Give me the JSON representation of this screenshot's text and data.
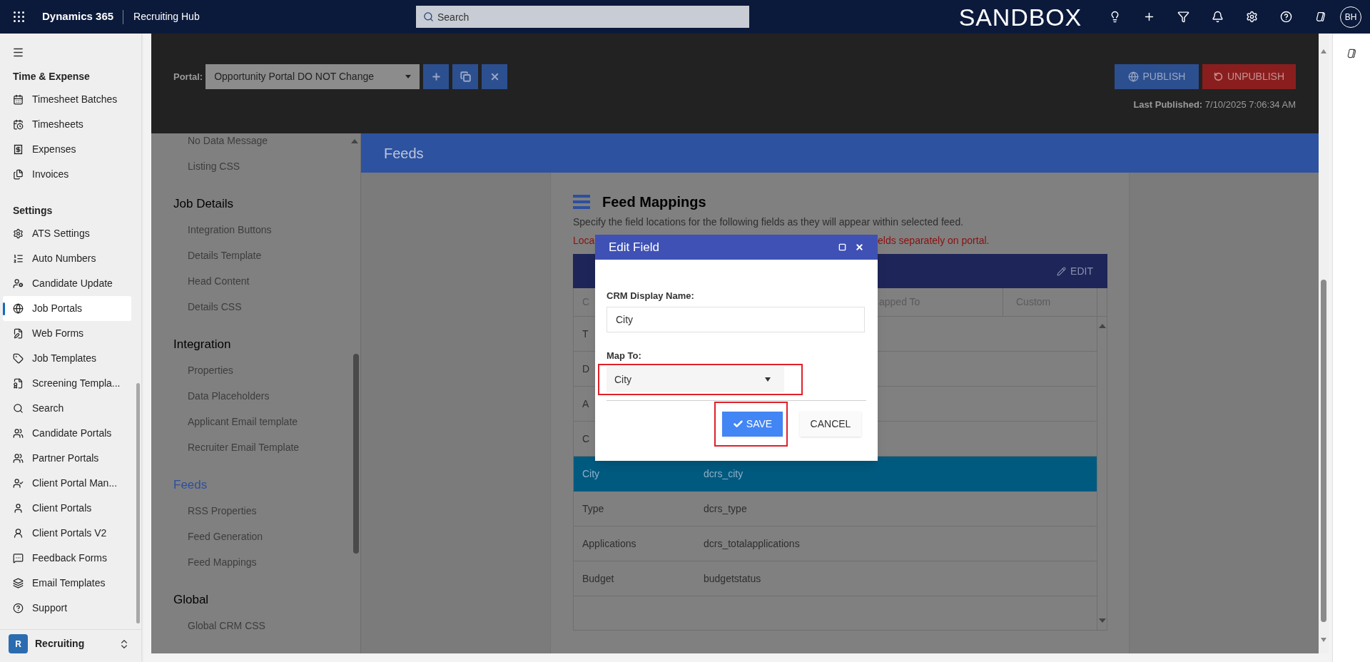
{
  "top_bar": {
    "app_name": "Dynamics 365",
    "area": "Recruiting Hub",
    "search": {
      "placeholder": "Search"
    },
    "environment": "SANDBOX",
    "user_initials": "BH"
  },
  "sidebar": {
    "groups": [
      {
        "title": "Time & Expense",
        "items": [
          {
            "label": "Timesheet Batches",
            "selected": false
          },
          {
            "label": "Timesheets",
            "selected": false
          },
          {
            "label": "Expenses",
            "selected": false
          },
          {
            "label": "Invoices",
            "selected": false
          }
        ]
      },
      {
        "title": "Settings",
        "items": [
          {
            "label": "ATS Settings",
            "selected": false
          },
          {
            "label": "Auto Numbers",
            "selected": false
          },
          {
            "label": "Candidate Update",
            "selected": false
          },
          {
            "label": "Job Portals",
            "selected": true
          },
          {
            "label": "Web Forms",
            "selected": false
          },
          {
            "label": "Job Templates",
            "selected": false
          },
          {
            "label": "Screening Templa...",
            "selected": false
          },
          {
            "label": "Search",
            "selected": false
          },
          {
            "label": "Candidate Portals",
            "selected": false
          },
          {
            "label": "Partner Portals",
            "selected": false
          },
          {
            "label": "Client Portal Man...",
            "selected": false
          },
          {
            "label": "Client Portals",
            "selected": false
          },
          {
            "label": "Client Portals V2",
            "selected": false
          },
          {
            "label": "Feedback Forms",
            "selected": false
          },
          {
            "label": "Email Templates",
            "selected": false
          },
          {
            "label": "Support",
            "selected": false
          }
        ]
      }
    ],
    "area_switcher": {
      "initial": "R",
      "label": "Recruiting"
    }
  },
  "portal_bar": {
    "label": "Portal:",
    "portal": "Opportunity Portal DO NOT Change",
    "publish": "PUBLISH",
    "unpublish": "UNPUBLISH",
    "last_published": "**Last Published:** 7/10/2025 7:06:34 AM"
  },
  "portal_menu": {
    "sections": [
      {
        "items": [
          "No Data Message",
          "Listing CSS"
        ]
      },
      {
        "title": "Job Details",
        "selected": false,
        "items": [
          "Integration Buttons",
          "Details Template",
          "Head Content",
          "Details CSS"
        ]
      },
      {
        "title": "Integration",
        "selected": false,
        "items": [
          "Properties",
          "Data Placeholders",
          "Applicant Email template",
          "Recruiter Email Template"
        ]
      },
      {
        "title": "Feeds",
        "selected": true,
        "items": [
          "RSS Properties",
          "Feed Generation",
          "Feed Mappings"
        ]
      },
      {
        "title": "Global",
        "selected": false,
        "items": [
          "Global CRM CSS"
        ]
      }
    ]
  },
  "page_header": "Feeds",
  "feed_mappings": {
    "title": "Feed Mappings",
    "description": "Specify the field locations for the following fields as they will appear within selected feed.",
    "warning_start": "Loca",
    "warning_end": "elds separately on portal.",
    "table": {
      "edit": "EDIT",
      "columns": [
        "C",
        "apped To",
        "Custom"
      ],
      "rows": [
        {
          "cells": [
            "T"
          ],
          "selected": false
        },
        {
          "cells": [
            "D"
          ],
          "selected": false
        },
        {
          "cells": [
            "A"
          ],
          "selected": false
        },
        {
          "cells": [
            "C"
          ],
          "selected": false
        },
        {
          "cells": [
            "City",
            "dcrs_city"
          ],
          "selected": true
        },
        {
          "cells": [
            "Type",
            "dcrs_type"
          ],
          "selected": false
        },
        {
          "cells": [
            "Applications",
            "dcrs_totalapplications"
          ],
          "selected": false
        },
        {
          "cells": [
            "Budget",
            "budgetstatus"
          ],
          "selected": false
        }
      ]
    }
  },
  "dialog": {
    "title": "Edit Field",
    "fields": [
      {
        "kind": "text",
        "label": "CRM Display Name:",
        "value": "City",
        "highlighted": false
      },
      {
        "kind": "select",
        "label": "Map To:",
        "value": "City",
        "highlighted": true
      }
    ],
    "buttons": [
      {
        "kind": "primary",
        "label": "SAVE",
        "highlighted": true
      },
      {
        "kind": "secondary",
        "label": "CANCEL",
        "highlighted": false
      }
    ]
  }
}
